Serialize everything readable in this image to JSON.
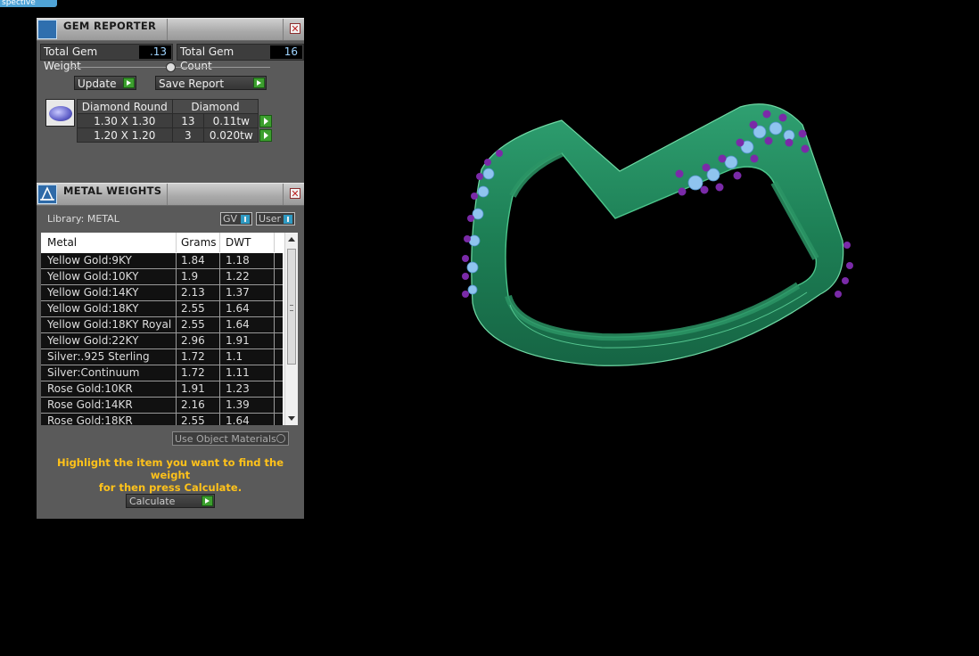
{
  "viewport": {
    "tab_label": "spective"
  },
  "gem_reporter": {
    "title": "GEM REPORTER",
    "total_gem_weight_label": "Total Gem Weight",
    "total_gem_weight": ".13",
    "total_gem_count_label": "Total Gem Count",
    "total_gem_count": "16",
    "update_label": "Update",
    "save_report_label": "Save Report",
    "table": {
      "header_shape": "Diamond Round",
      "header_material": "Diamond",
      "rows": [
        {
          "size": "1.30 X 1.30",
          "count": "13",
          "weight": "0.11tw"
        },
        {
          "size": "1.20 X 1.20",
          "count": "3",
          "weight": "0.020tw"
        }
      ]
    }
  },
  "metal_weights": {
    "title": "METAL WEIGHTS",
    "library_label": "Library: METAL",
    "toggle_gv": "GV",
    "toggle_user": "User",
    "columns": [
      "Metal",
      "Grams",
      "DWT"
    ],
    "rows": [
      {
        "metal": "Yellow Gold:9KY",
        "grams": "1.84",
        "dwt": "1.18"
      },
      {
        "metal": "Yellow Gold:10KY",
        "grams": "1.9",
        "dwt": "1.22"
      },
      {
        "metal": "Yellow Gold:14KY",
        "grams": "2.13",
        "dwt": "1.37"
      },
      {
        "metal": "Yellow Gold:18KY",
        "grams": "2.55",
        "dwt": "1.64"
      },
      {
        "metal": "Yellow Gold:18KY Royal",
        "grams": "2.55",
        "dwt": "1.64"
      },
      {
        "metal": "Yellow Gold:22KY",
        "grams": "2.96",
        "dwt": "1.91"
      },
      {
        "metal": "Silver:.925 Sterling",
        "grams": "1.72",
        "dwt": "1.1"
      },
      {
        "metal": "Silver:Continuum",
        "grams": "1.72",
        "dwt": "1.11"
      },
      {
        "metal": "Rose Gold:10KR",
        "grams": "1.91",
        "dwt": "1.23"
      },
      {
        "metal": "Rose Gold:14KR",
        "grams": "2.16",
        "dwt": "1.39"
      },
      {
        "metal": "Rose Gold:18KR",
        "grams": "2.55",
        "dwt": "1.64"
      }
    ],
    "use_object_materials_label": "Use Object Materials",
    "hint_line1": "Highlight the item you want to find the weight",
    "hint_line2": "for then press Calculate.",
    "calculate_label": "Calculate"
  },
  "colors": {
    "band": "#1f8a5e",
    "gem_settings": "#8fc4ef",
    "prongs": "#7a2aa8",
    "accent_green": "#3c9f2e",
    "hint": "#ffc21a"
  }
}
